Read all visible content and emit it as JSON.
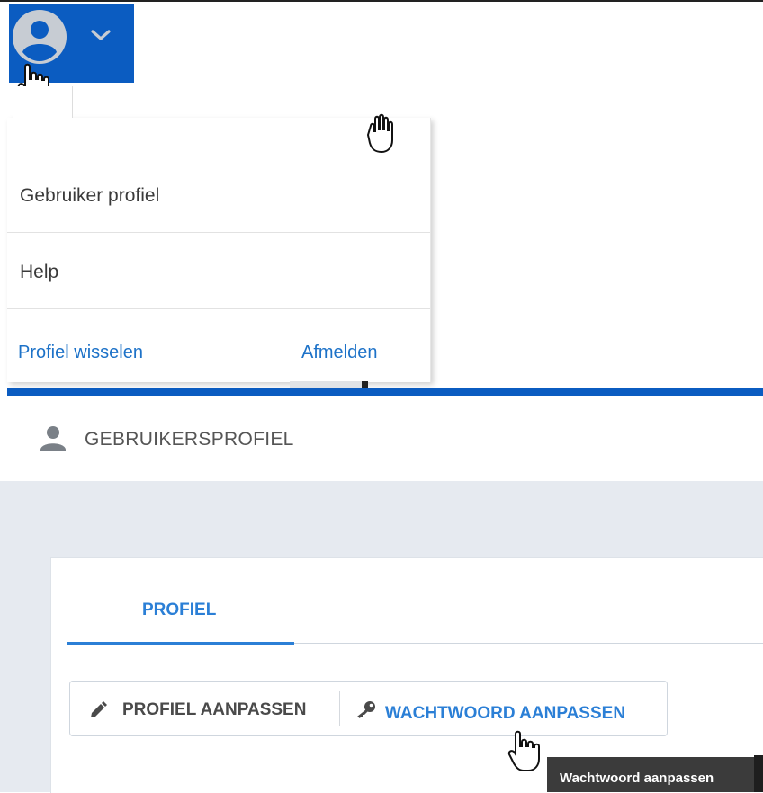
{
  "menu": {
    "items": [
      {
        "label": "Gebruiker profiel"
      },
      {
        "label": "Help"
      }
    ],
    "switch_profile": "Profiel wisselen",
    "logout": "Afmelden"
  },
  "header": {
    "title": "GEBRUIKERSPROFIEL"
  },
  "tabs": [
    {
      "label": "PROFIEL",
      "active": true
    }
  ],
  "actions": {
    "edit_profile": "PROFIEL AANPASSEN",
    "change_password": "WACHTWOORD AANPASSEN"
  },
  "tooltip": "Wachtwoord aanpassen",
  "colors": {
    "brand_blue": "#0b5cc1",
    "link_blue": "#2b7fd6",
    "content_bg": "#e6eaf0"
  },
  "icons": [
    "account-circle-icon",
    "chevron-down-icon",
    "hand-cursor-icon",
    "person-icon",
    "pencil-icon",
    "key-icon"
  ]
}
